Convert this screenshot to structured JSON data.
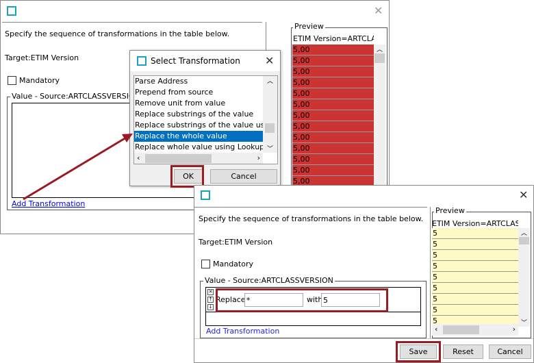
{
  "back_window": {
    "instruction": "Specify the sequence of transformations in the table below.",
    "target": "Target:ETIM Version",
    "mandatory_label": "Mandatory",
    "value_group": "Value - Source:ARTCLASSVERSION",
    "add_transformation": "Add Transformation",
    "preview": {
      "title": "Preview",
      "header": "ETIM Version=ARTCLASS",
      "rows": [
        "5,00",
        "5,00",
        "5,00",
        "5,00",
        "5,00",
        "5,00",
        "5,00",
        "5,00",
        "5,00",
        "5,00",
        "5,00",
        "5,00",
        "5,00"
      ]
    }
  },
  "select_dialog": {
    "title": "Select Transformation",
    "items": [
      "Parse Address",
      "Prepend from source",
      "Remove unit from value",
      "Replace substrings of the value",
      "Replace substrings of the value using a",
      "Replace the whole value",
      "Replace whole value using Lookup Table"
    ],
    "selected_index": 5,
    "ok": "OK",
    "cancel": "Cancel"
  },
  "front_window": {
    "instruction": "Specify the sequence of transformations in the table below.",
    "target": "Target:ETIM Version",
    "mandatory_label": "Mandatory",
    "value_group": "Value - Source:ARTCLASSVERSION",
    "replace_label": "Replace",
    "replace_value": "*",
    "with_label": "with",
    "with_value": "5",
    "add_transformation": "Add Transformation",
    "preview": {
      "title": "Preview",
      "header": "ETIM Version=ARTCLASSV",
      "rows": [
        "5",
        "5",
        "5",
        "5",
        "5",
        "5",
        "5",
        "5",
        "5"
      ]
    },
    "save": "Save",
    "reset": "Reset",
    "cancel": "Cancel"
  },
  "colors": {
    "accent": "#9b1b22",
    "error_row": "#cc3333",
    "ok_row": "#fff9c4",
    "selection": "#0070c0"
  }
}
